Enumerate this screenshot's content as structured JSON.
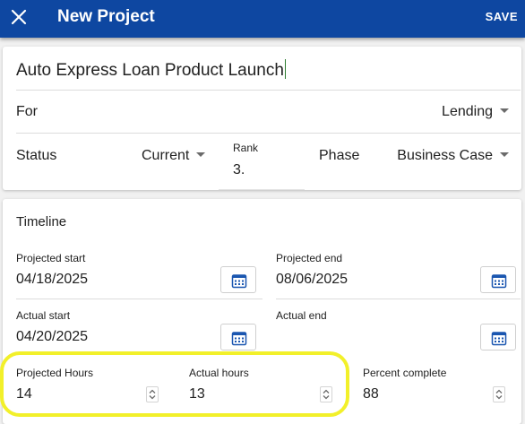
{
  "header": {
    "title": "New Project",
    "save_label": "SAVE",
    "close_icon": "close-icon",
    "bg_color": "#0e47a1"
  },
  "project": {
    "title": "Auto Express Loan Product Launch",
    "for_label": "For",
    "for_value": "Lending",
    "status_label": "Status",
    "status_value": "Current",
    "rank_label": "Rank",
    "rank_value": "3.",
    "phase_label": "Phase",
    "phase_value": "Business Case"
  },
  "timeline": {
    "heading": "Timeline",
    "projected_start_label": "Projected start",
    "projected_start_value": "04/18/2025",
    "projected_end_label": "Projected end",
    "projected_end_value": "08/06/2025",
    "actual_start_label": "Actual start",
    "actual_start_value": "04/20/2025",
    "actual_end_label": "Actual end",
    "actual_end_value": "",
    "projected_hours_label": "Projected Hours",
    "projected_hours_value": "14",
    "actual_hours_label": "Actual hours",
    "actual_hours_value": "13",
    "percent_complete_label": "Percent complete",
    "percent_complete_value": "88"
  },
  "colors": {
    "accent": "#0e47a1",
    "calendar_icon": "#1a56b0",
    "highlight": "#f2f02a",
    "caret": "#2e7d32"
  }
}
